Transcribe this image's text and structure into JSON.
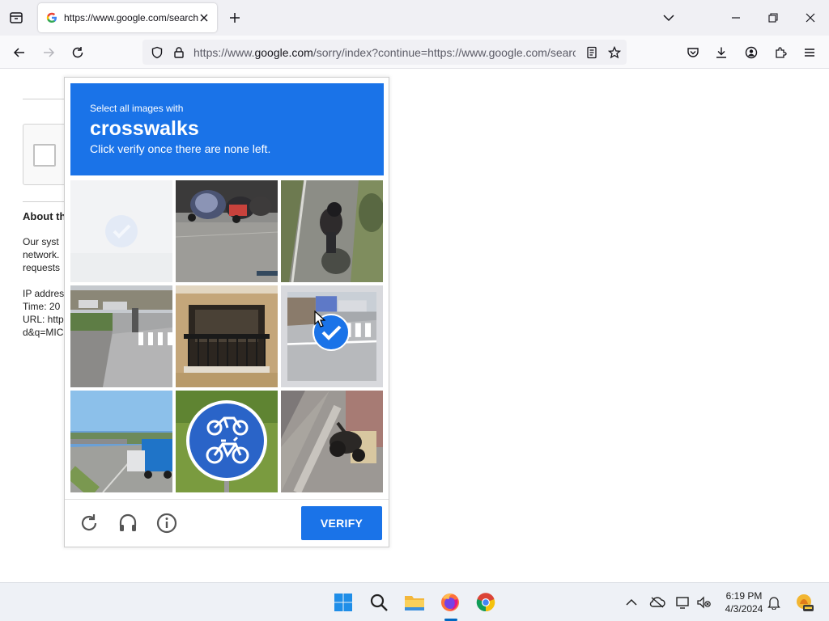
{
  "browser": {
    "tab": {
      "title": "https://www.google.com/search",
      "favicon": "google-g-icon"
    },
    "url": {
      "prefix": "https://www.",
      "domain": "google.com",
      "rest": "/sorry/index?continue=https://www.google.com/search"
    }
  },
  "page": {
    "about_heading": "About th",
    "body_text": "Our syst\nnetwork.\nrequests\n\nIP addres\nTime: 20\nURL: http\nd&q=MIC"
  },
  "captcha": {
    "instruction_line1": "Select all images with",
    "target": "crosswalks",
    "instruction_line3": "Click verify once there are none left.",
    "verify_label": "VERIFY",
    "accent_color": "#1a73e8",
    "tiles": [
      {
        "name": "tile-1",
        "state": "fading-selected"
      },
      {
        "name": "tile-2",
        "state": "unselected"
      },
      {
        "name": "tile-3",
        "state": "unselected"
      },
      {
        "name": "tile-4",
        "state": "unselected"
      },
      {
        "name": "tile-5",
        "state": "unselected"
      },
      {
        "name": "tile-6",
        "state": "selected"
      },
      {
        "name": "tile-7",
        "state": "unselected"
      },
      {
        "name": "tile-8",
        "state": "unselected"
      },
      {
        "name": "tile-9",
        "state": "unselected"
      }
    ]
  },
  "taskbar": {
    "time": "6:19 PM",
    "date": "4/3/2024"
  }
}
